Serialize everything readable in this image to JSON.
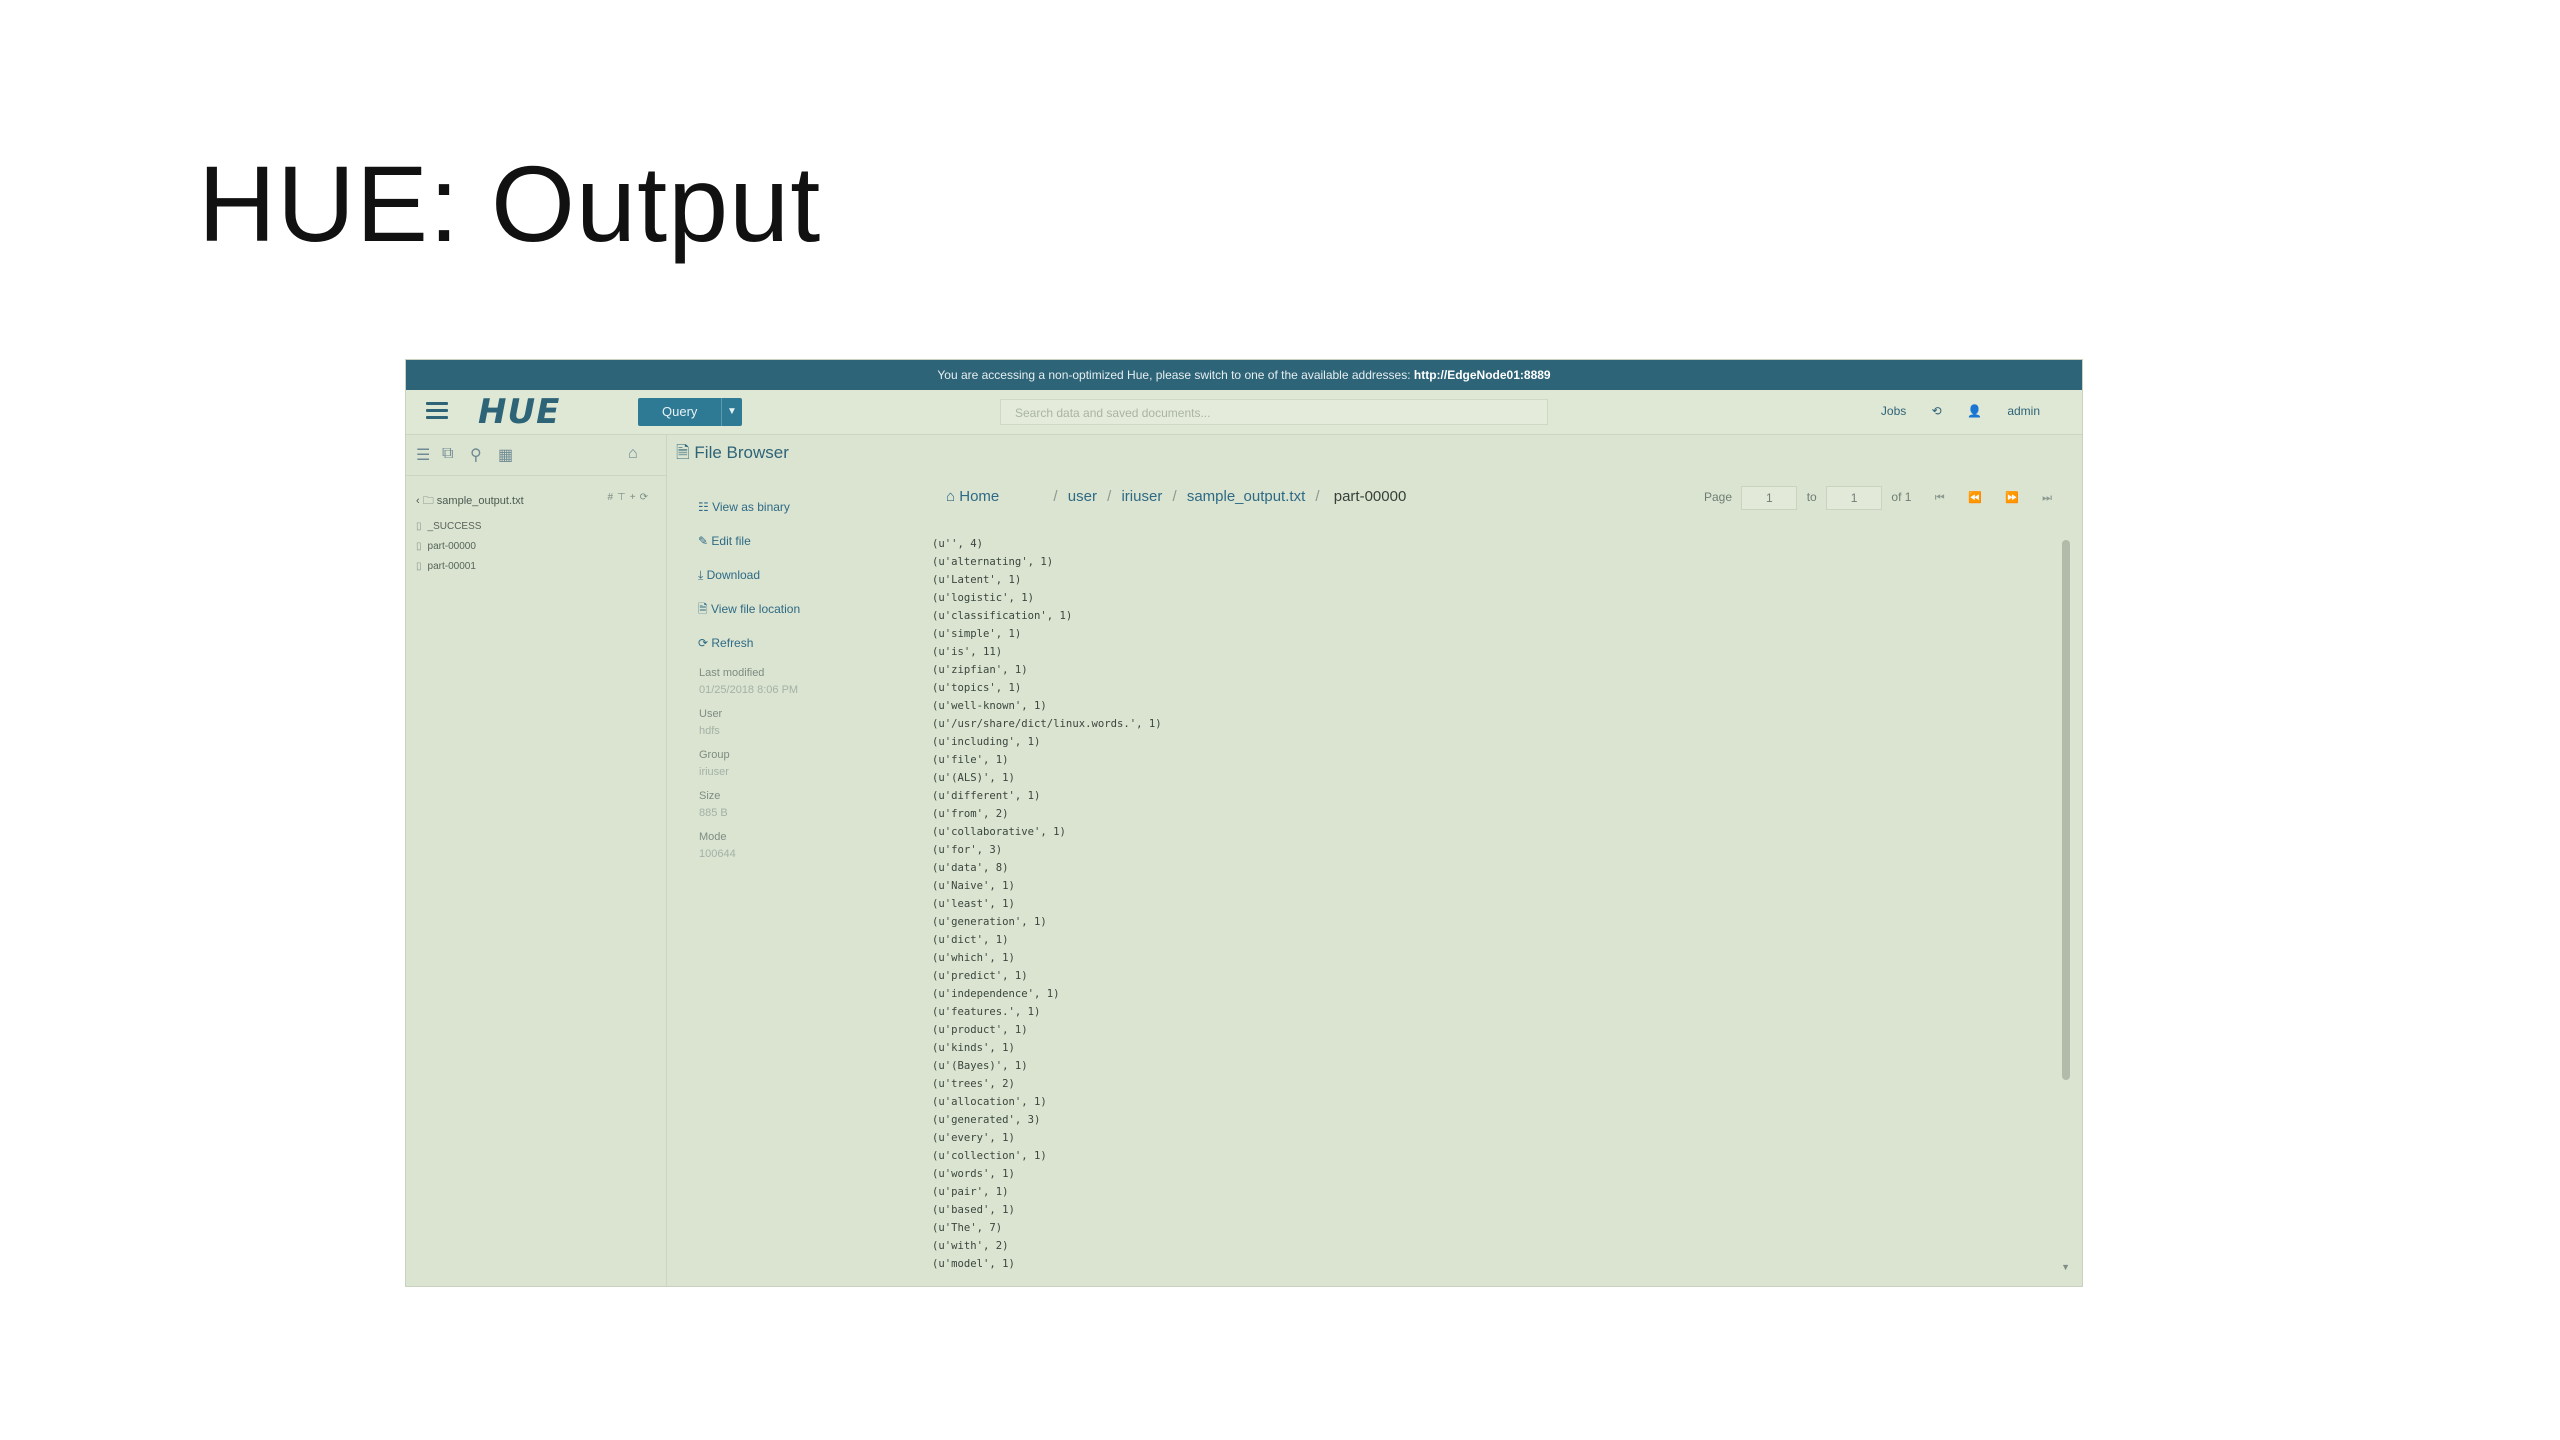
{
  "slide": {
    "title": "HUE: Output"
  },
  "hue": {
    "banner": {
      "text": "You are accessing a non-optimized Hue, please switch to one of the available addresses:",
      "link": "http://EdgeNode01:8889"
    },
    "nav": {
      "logo": "HUE",
      "query_label": "Query",
      "search_placeholder": "Search data and saved documents...",
      "jobs_label": "Jobs",
      "user_label": "admin"
    },
    "left_panel": {
      "folder": "sample_output.txt",
      "files": [
        "_SUCCESS",
        "part-00000",
        "part-00001"
      ]
    },
    "file_browser": {
      "title": "File Browser",
      "actions": [
        "View as binary",
        "Edit file",
        "Download",
        "View file location",
        "Refresh"
      ],
      "meta": [
        {
          "label": "Last modified",
          "value": "01/25/2018 8:06 PM"
        },
        {
          "label": "User",
          "value": "hdfs"
        },
        {
          "label": "Group",
          "value": "iriuser"
        },
        {
          "label": "Size",
          "value": "885 B"
        },
        {
          "label": "Mode",
          "value": "100644"
        }
      ]
    },
    "breadcrumb": {
      "home": "Home",
      "parts": [
        "user",
        "iriuser",
        "sample_output.txt"
      ],
      "current": "part-00000"
    },
    "pager": {
      "page_label": "Page",
      "page_value": "1",
      "to_label": "to",
      "to_value": "1",
      "of_label": "of 1"
    },
    "content_lines": [
      "(u'', 4)",
      "(u'alternating', 1)",
      "(u'Latent', 1)",
      "(u'logistic', 1)",
      "(u'classification', 1)",
      "(u'simple', 1)",
      "(u'is', 11)",
      "(u'zipfian', 1)",
      "(u'topics', 1)",
      "(u'well-known', 1)",
      "(u'/usr/share/dict/linux.words.', 1)",
      "(u'including', 1)",
      "(u'file', 1)",
      "(u'(ALS)', 1)",
      "(u'different', 1)",
      "(u'from', 2)",
      "(u'collaborative', 1)",
      "(u'for', 3)",
      "(u'data', 8)",
      "(u'Naive', 1)",
      "(u'least', 1)",
      "(u'generation', 1)",
      "(u'dict', 1)",
      "(u'which', 1)",
      "(u'predict', 1)",
      "(u'independence', 1)",
      "(u'features.', 1)",
      "(u'product', 1)",
      "(u'kinds', 1)",
      "(u'(Bayes)', 1)",
      "(u'trees', 2)",
      "(u'allocation', 1)",
      "(u'generated', 3)",
      "(u'every', 1)",
      "(u'collection', 1)",
      "(u'words', 1)",
      "(u'pair', 1)",
      "(u'based', 1)",
      "(u'The', 7)",
      "(u'with', 2)",
      "(u'model', 1)"
    ]
  }
}
